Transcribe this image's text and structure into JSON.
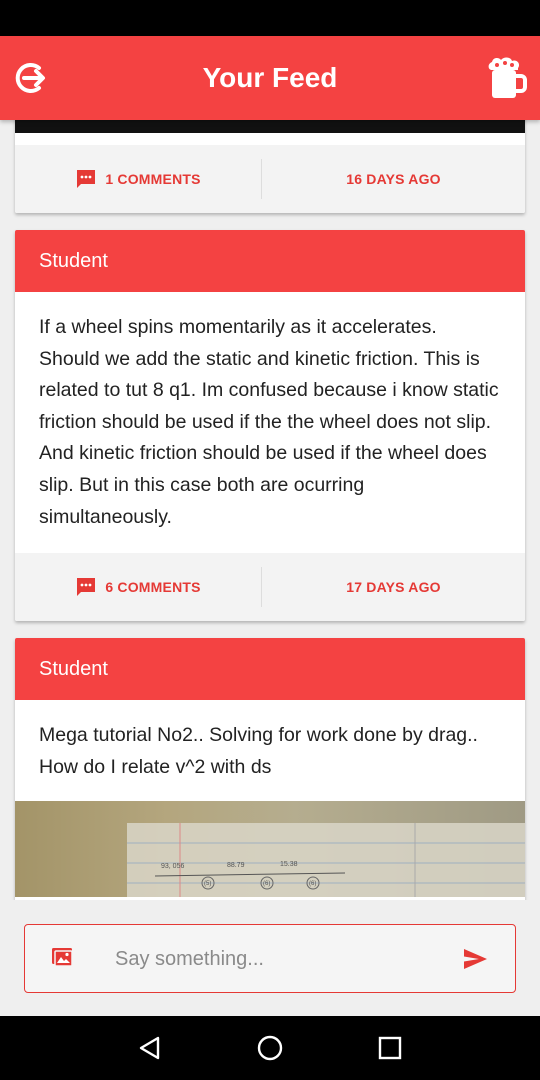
{
  "app_bar": {
    "title": "Your Feed",
    "left_icon": "logout-icon",
    "right_icon": "beer-mug-icon"
  },
  "posts": [
    {
      "comments_label": "1 COMMENTS",
      "time_label": "16 DAYS AGO"
    },
    {
      "author": "Student",
      "body": "If a wheel spins momentarily as it accelerates. Should we add the static and kinetic friction. This is related to tut 8 q1. Im confused because i know static friction should be used if the the wheel does not slip. And kinetic friction should be used if the wheel does slip. But in this case both are ocurring simultaneously.",
      "comments_label": "6 COMMENTS",
      "time_label": "17 DAYS AGO"
    },
    {
      "author": "Student",
      "body": "Mega tutorial No2.. Solving for work done by drag.. How do I relate v^2 with ds",
      "image_text": [
        "93, 056",
        "88.79",
        "15.38",
        "(5)",
        "(6)",
        "(6)"
      ]
    }
  ],
  "composer": {
    "placeholder": "Say something...",
    "value": ""
  },
  "colors": {
    "accent": "#f44242",
    "accent_text": "#e53935",
    "background": "#efefef"
  }
}
